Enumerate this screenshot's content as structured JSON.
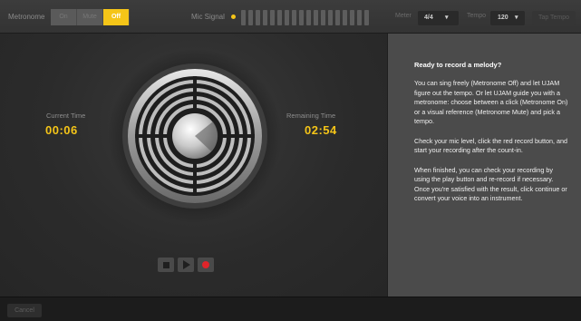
{
  "topbar": {
    "metronome_label": "Metronome",
    "metronome_options": [
      "On",
      "Mute",
      "Off"
    ],
    "metronome_selected": "Off",
    "mic_signal_label": "Mic Signal",
    "meter_label": "Meter",
    "meter_value": "4/4",
    "meter_chevron": "▾",
    "tempo_label": "Tempo",
    "tempo_value": "120",
    "tempo_chevron": "▾",
    "tap_tempo_label": "Tap Tempo"
  },
  "main": {
    "current_time_label": "Current Time",
    "current_time_value": "00:06",
    "remaining_time_label": "Remaining Time",
    "remaining_time_value": "02:54"
  },
  "panel": {
    "title": "Ready to record a melody?",
    "paragraphs": [
      "You can sing freely (Metronome Off) and let UJAM figure out the tempo. Or let UJAM guide you with a metronome: choose between a click (Metronome On) or a visual reference (Metronome Mute) and pick a tempo.",
      "Check your mic level, click the red record button, and start your recording after the count-in.",
      "When finished, you can check your recording by using the play button and re-record if necessary. Once you're satisfied with the result, click continue or convert your voice into an instrument."
    ]
  },
  "footer": {
    "cancel_label": "Cancel"
  },
  "colors": {
    "accent": "#f5c518",
    "record": "#e0242a"
  },
  "icons": {
    "stop": "stop-icon",
    "play": "play-icon",
    "record": "record-icon"
  }
}
